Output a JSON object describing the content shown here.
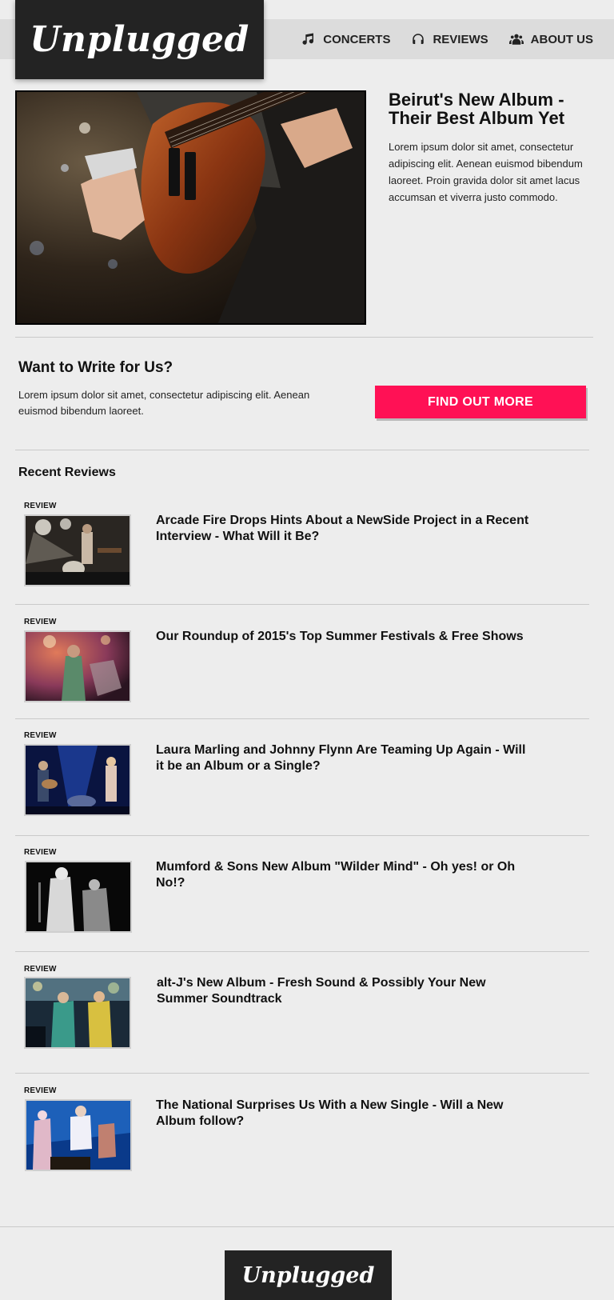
{
  "brand": {
    "logo_text": "Unplugged"
  },
  "nav": {
    "items": [
      {
        "label": "CONCERTS",
        "icon": "music-note-icon"
      },
      {
        "label": "REVIEWS",
        "icon": "headphones-icon"
      },
      {
        "label": "ABOUT US",
        "icon": "users-icon"
      }
    ]
  },
  "hero": {
    "title": "Beirut's New Album - Their Best Album Yet",
    "body": "Lorem ipsum dolor sit amet, consectetur adipiscing elit. Aenean euismod bibendum laoreet. Proin gravida dolor sit amet lacus accumsan et viverra justo commodo."
  },
  "cta": {
    "title": "Want to Write for Us?",
    "body": "Lorem ipsum dolor sit amet, consectetur adipiscing elit. Aenean euismod bibendum laoreet.",
    "button_label": "FIND OUT MORE"
  },
  "recent_reviews": {
    "heading": "Recent Reviews",
    "items": [
      {
        "tag": "REVIEW",
        "title": "Arcade Fire Drops Hints About a NewSide Project in a Recent Interview - What Will it Be?"
      },
      {
        "tag": "REVIEW",
        "title": "Our Roundup of 2015's Top Summer Festivals & Free Shows"
      },
      {
        "tag": "REVIEW",
        "title": "Laura Marling and Johnny Flynn Are Teaming Up Again - Will it be an Album or a Single?"
      },
      {
        "tag": "REVIEW",
        "title": "Mumford & Sons New Album \"Wilder Mind\" - Oh yes! or Oh No!?"
      },
      {
        "tag": "REVIEW",
        "title": "alt-J's New Album - Fresh Sound & Possibly Your New Summer Soundtrack"
      },
      {
        "tag": "REVIEW",
        "title": "The National Surprises Us With a New Single - Will a New Album follow?"
      }
    ]
  },
  "footer": {
    "logo_text": "Unplugged"
  },
  "colors": {
    "accent": "#ff1155",
    "logo_bg": "#232323",
    "page_bg": "#ededed",
    "nav_bg": "#dcdcdc"
  }
}
